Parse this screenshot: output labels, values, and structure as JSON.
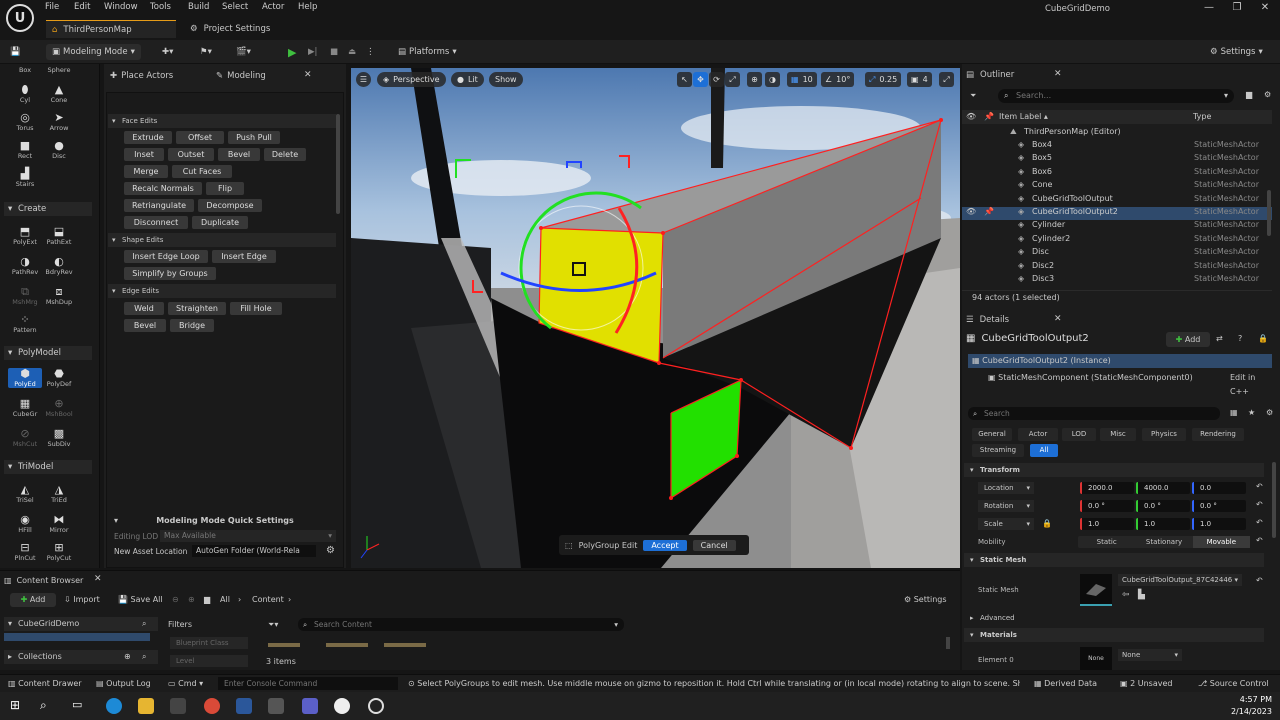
{
  "menubar": {
    "logo": "U",
    "items": [
      "File",
      "Edit",
      "Window",
      "Tools",
      "Build",
      "Select",
      "Actor",
      "Help"
    ],
    "map_tab": "ThirdPersonMap",
    "project_settings": "Project Settings",
    "app_name": "CubeGridDemo"
  },
  "toolbar": {
    "mode": "Modeling Mode",
    "platforms": "Platforms",
    "settings": "Settings"
  },
  "palette": {
    "top_tools": [
      "Box",
      "Sphere",
      "Cyl",
      "Cone",
      "Torus",
      "Arrow",
      "Rect",
      "Disc",
      "Stairs"
    ],
    "create_header": "Create",
    "create_tools": [
      "PolyExt",
      "PathExt",
      "PathRev",
      "BdryRev",
      "MshMrg",
      "MshDup",
      "Pattern"
    ],
    "polymodel_header": "PolyModel",
    "polymodel_tools": [
      "PolyEd",
      "PolyDef",
      "CubeGr",
      "MshBool",
      "MshCut",
      "SubDiv"
    ],
    "trimodel_header": "TriModel",
    "trimodel_tools": [
      "TriSel",
      "TriEd",
      "HFill",
      "Mirror",
      "PlnCut",
      "PolyCut"
    ]
  },
  "modeling_panel": {
    "tab_place": "Place Actors",
    "tab_modeling": "Modeling",
    "face_edits": "Face Edits",
    "face_buttons": [
      "Extrude",
      "Offset",
      "Push Pull",
      "Inset",
      "Outset",
      "Bevel",
      "Delete",
      "Merge",
      "Cut Faces",
      "Recalc Normals",
      "Flip",
      "Retriangulate",
      "Decompose",
      "Disconnect",
      "Duplicate"
    ],
    "shape_edits": "Shape Edits",
    "shape_buttons": [
      "Insert Edge Loop",
      "Insert Edge",
      "Simplify by Groups"
    ],
    "edge_edits": "Edge Edits",
    "edge_buttons": [
      "Weld",
      "Straighten",
      "Fill Hole",
      "Bevel",
      "Bridge"
    ],
    "quick_settings": "Modeling Mode Quick Settings",
    "editing_lod_label": "Editing LOD",
    "editing_lod_value": "Max Available",
    "new_asset_label": "New Asset Location",
    "new_asset_value": "AutoGen Folder (World-Rela"
  },
  "viewport": {
    "perspective": "Perspective",
    "lit": "Lit",
    "show": "Show",
    "grid_snap": "10",
    "rot_snap": "10°",
    "scale_snap": "0.25",
    "camera_speed": "4",
    "polygroup_edit": "PolyGroup Edit",
    "accept": "Accept",
    "cancel": "Cancel"
  },
  "outliner": {
    "title": "Outliner",
    "search_placeholder": "Search...",
    "col_label": "Item Label ▴",
    "col_type": "Type",
    "root": "ThirdPersonMap (Editor)",
    "rows": [
      {
        "name": "Box4",
        "type": "StaticMeshActor"
      },
      {
        "name": "Box5",
        "type": "StaticMeshActor"
      },
      {
        "name": "Box6",
        "type": "StaticMeshActor"
      },
      {
        "name": "Cone",
        "type": "StaticMeshActor"
      },
      {
        "name": "CubeGridToolOutput",
        "type": "StaticMeshActor"
      },
      {
        "name": "CubeGridToolOutput2",
        "type": "StaticMeshActor"
      },
      {
        "name": "Cylinder",
        "type": "StaticMeshActor"
      },
      {
        "name": "Cylinder2",
        "type": "StaticMeshActor"
      },
      {
        "name": "Disc",
        "type": "StaticMeshActor"
      },
      {
        "name": "Disc2",
        "type": "StaticMeshActor"
      },
      {
        "name": "Disc3",
        "type": "StaticMeshActor"
      }
    ],
    "selected_index": 5,
    "footer": "94 actors (1 selected)"
  },
  "details": {
    "title": "Details",
    "actor_name": "CubeGridToolOutput2",
    "add": "Add",
    "instance": "CubeGridToolOutput2 (Instance)",
    "component": "StaticMeshComponent (StaticMeshComponent0)",
    "edit_cpp": "Edit in C++",
    "search_placeholder": "Search",
    "tabs": [
      "General",
      "Actor",
      "LOD",
      "Misc",
      "Physics",
      "Rendering",
      "Streaming",
      "All"
    ],
    "active_tab": "All",
    "transform": "Transform",
    "location_label": "Location",
    "location": [
      "2000.0",
      "4000.0",
      "0.0"
    ],
    "rotation_label": "Rotation",
    "rotation": [
      "0.0 °",
      "0.0 °",
      "0.0 °"
    ],
    "scale_label": "Scale",
    "scale": [
      "1.0",
      "1.0",
      "1.0"
    ],
    "mobility_label": "Mobility",
    "mobility_options": [
      "Static",
      "Stationary",
      "Movable"
    ],
    "mobility_selected": "Movable",
    "static_mesh_section": "Static Mesh",
    "static_mesh_label": "Static Mesh",
    "static_mesh_value": "CubeGridToolOutput_87C42446",
    "advanced": "Advanced",
    "materials": "Materials",
    "element0": "Element 0",
    "element0_value": "None",
    "thumb_none": "None"
  },
  "content_browser": {
    "title": "Content Browser",
    "add": "Add",
    "import": "Import",
    "save_all": "Save All",
    "path_all": "All",
    "path_content": "Content",
    "settings": "Settings",
    "project": "CubeGridDemo",
    "collections": "Collections",
    "filters": "Filters",
    "filter_items": [
      "Blueprint Class",
      "Level"
    ],
    "search_placeholder": "Search Content",
    "items_count": "3 items"
  },
  "statusbar": {
    "content_drawer": "Content Drawer",
    "output_log": "Output Log",
    "cmd": "Cmd",
    "console_placeholder": "Enter Console Command",
    "message": "Select PolyGroups to edit mesh. Use middle mouse on gizmo to reposition it. Hold Ctrl while translating or (in local mode) rotating to align to scene. Shift and C",
    "derived_data": "Derived Data",
    "unsaved": "2 Unsaved",
    "source_control": "Source Control"
  },
  "taskbar": {
    "time": "4:57 PM",
    "date": "2/14/2023"
  }
}
